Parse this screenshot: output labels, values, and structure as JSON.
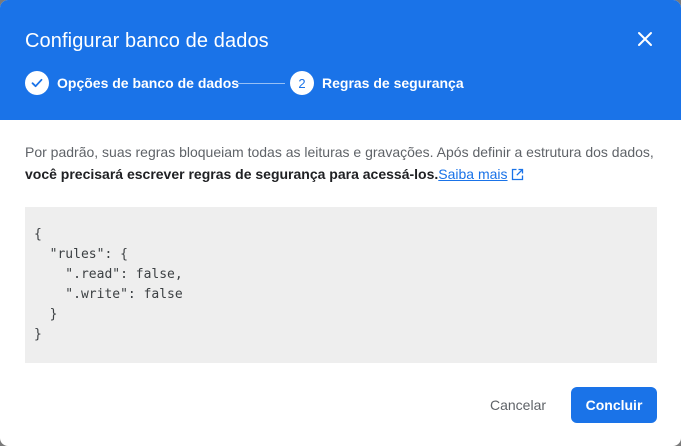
{
  "dialog": {
    "title": "Configurar banco de dados",
    "close_icon": "close-icon"
  },
  "stepper": {
    "steps": [
      {
        "label": "Opções de banco de dados",
        "indicator": "check-icon",
        "state": "completed"
      },
      {
        "label": "Regras de segurança",
        "indicator": "2",
        "state": "active"
      }
    ]
  },
  "description": {
    "text": "Por padrão, suas regras bloqueiam todas as leituras e gravações. Após definir a estrutura dos dados,",
    "bold_text": "você precisará escrever regras de segurança para acessá-los.",
    "link_label": "Saiba mais",
    "link_icon": "open-in-new-icon"
  },
  "code": {
    "lines": [
      "{",
      "  \"rules\": {",
      "    \".read\": false,",
      "    \".write\": false",
      "  }",
      "}"
    ]
  },
  "actions": {
    "cancel_label": "Cancelar",
    "done_label": "Concluir"
  },
  "colors": {
    "header": "#1a73e8",
    "primary_button": "#1a73e8",
    "code_background": "#eeeeee"
  }
}
